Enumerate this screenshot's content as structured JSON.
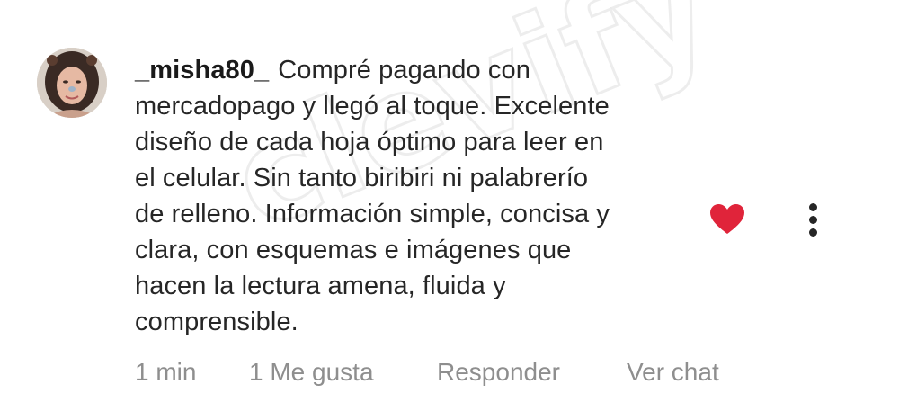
{
  "comment": {
    "username": "_misha80_",
    "text_lines": [
      "Compré pagando con",
      "mercadopago y llegó al toque. Excelente",
      "diseño de cada hoja óptimo para leer en",
      "el celular. Sin tanto biribiri ni palabrerío",
      "de relleno. Información simple, concisa y",
      "clara, con esquemas e imágenes que",
      "hacen la lectura amena, fluida y",
      "comprensible."
    ],
    "liked": true,
    "like_color": "#e0243a",
    "meta": {
      "time": "1 min",
      "likes": "1 Me gusta",
      "reply": "Responder",
      "chat": "Ver chat"
    }
  },
  "watermark": "clevify",
  "icons": {
    "like": "heart-icon",
    "more": "more-vertical-icon",
    "avatar": "user-avatar"
  }
}
